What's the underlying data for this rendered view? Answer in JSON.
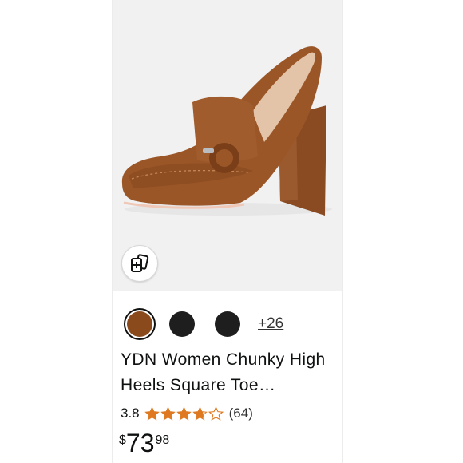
{
  "product": {
    "title": "YDN Women Chunky High Heels Square Toe…",
    "rating": "3.8",
    "rating_value": 3.8,
    "review_count": "(64)",
    "price_symbol": "$",
    "price_whole": "73",
    "price_fraction": "98"
  },
  "swatches": {
    "colors": [
      "#8b4a1c",
      "#1e1e1e",
      "#1e1e1e"
    ],
    "more_label": "+26"
  },
  "icons": {
    "similar": "view-similar-icon",
    "star": "star-icon"
  },
  "colors": {
    "star_fill": "#de7921",
    "text": "#0f1111",
    "image_bg": "#f1f1f1"
  }
}
